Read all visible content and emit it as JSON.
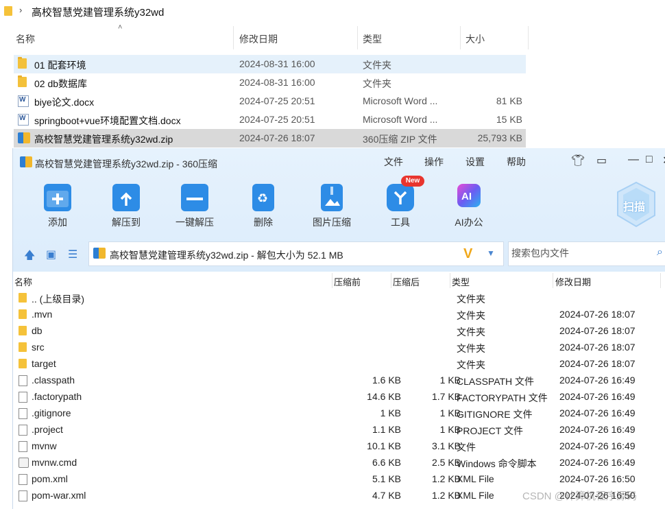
{
  "explorer": {
    "breadcrumb": "高校智慧党建管理系统y32wd",
    "columns": {
      "name": "名称",
      "modified": "修改日期",
      "type": "类型",
      "size": "大小"
    },
    "rows": [
      {
        "name": "01 配套环境",
        "date": "2024-08-31 16:00",
        "type": "文件夹",
        "size": ""
      },
      {
        "name": "02 db数据库",
        "date": "2024-08-31 16:00",
        "type": "文件夹",
        "size": ""
      },
      {
        "name": "biye论文.docx",
        "date": "2024-07-25 20:51",
        "type": "Microsoft Word ...",
        "size": "81 KB"
      },
      {
        "name": "springboot+vue环境配置文档.docx",
        "date": "2024-07-25 20:51",
        "type": "Microsoft Word ...",
        "size": "15 KB"
      },
      {
        "name": "高校智慧党建管理系统y32wd.zip",
        "date": "2024-07-26 18:07",
        "type": "360压缩 ZIP 文件",
        "size": "25,793 KB"
      }
    ]
  },
  "zip": {
    "title": "高校智慧党建管理系统y32wd.zip - 360压缩",
    "menu": [
      "文件",
      "操作",
      "设置",
      "帮助"
    ],
    "toolbar": [
      {
        "label": "添加",
        "icon": "add-icon",
        "color": "#2d8ce6"
      },
      {
        "label": "解压到",
        "icon": "extract-icon",
        "color": "#2d8ce6"
      },
      {
        "label": "一键解压",
        "icon": "one-click-extract-icon",
        "color": "#2d8ce6"
      },
      {
        "label": "删除",
        "icon": "recycle-icon",
        "color": "#2d8ce6"
      },
      {
        "label": "图片压缩",
        "icon": "image-compress-icon",
        "color": "#2d8ce6"
      },
      {
        "label": "工具",
        "icon": "tools-icon",
        "color": "#2d8ce6"
      },
      {
        "label": "AI办公",
        "icon": "ai-icon",
        "color": "#7b5cf0"
      }
    ],
    "new_badge": "New",
    "scan_label": "扫描",
    "address": "高校智慧党建管理系统y32wd.zip - 解包大小为 52.1 MB",
    "search_placeholder": "搜索包内文件",
    "columns": {
      "name": "名称",
      "compressed_before": "压缩前",
      "compressed_after": "压缩后",
      "type": "类型",
      "modified": "修改日期"
    },
    "rows": [
      {
        "name": ".. (上级目录)",
        "before": "",
        "after": "",
        "type": "文件夹",
        "date": "",
        "icon": "folder"
      },
      {
        "name": ".mvn",
        "before": "",
        "after": "",
        "type": "文件夹",
        "date": "2024-07-26 18:07",
        "icon": "folder"
      },
      {
        "name": "db",
        "before": "",
        "after": "",
        "type": "文件夹",
        "date": "2024-07-26 18:07",
        "icon": "folder"
      },
      {
        "name": "src",
        "before": "",
        "after": "",
        "type": "文件夹",
        "date": "2024-07-26 18:07",
        "icon": "folder"
      },
      {
        "name": "target",
        "before": "",
        "after": "",
        "type": "文件夹",
        "date": "2024-07-26 18:07",
        "icon": "folder"
      },
      {
        "name": ".classpath",
        "before": "1.6 KB",
        "after": "1 KB",
        "type": "CLASSPATH 文件",
        "date": "2024-07-26 16:49",
        "icon": "file"
      },
      {
        "name": ".factorypath",
        "before": "14.6 KB",
        "after": "1.7 KB",
        "type": "FACTORYPATH 文件",
        "date": "2024-07-26 16:49",
        "icon": "file"
      },
      {
        "name": ".gitignore",
        "before": "1 KB",
        "after": "1 KB",
        "type": "GITIGNORE 文件",
        "date": "2024-07-26 16:49",
        "icon": "file"
      },
      {
        "name": ".project",
        "before": "1.1 KB",
        "after": "1 KB",
        "type": "PROJECT 文件",
        "date": "2024-07-26 16:49",
        "icon": "file"
      },
      {
        "name": "mvnw",
        "before": "10.1 KB",
        "after": "3.1 KB",
        "type": "文件",
        "date": "2024-07-26 16:49",
        "icon": "file"
      },
      {
        "name": "mvnw.cmd",
        "before": "6.6 KB",
        "after": "2.5 KB",
        "type": "Windows 命令脚本",
        "date": "2024-07-26 16:49",
        "icon": "cmd"
      },
      {
        "name": "pom.xml",
        "before": "5.1 KB",
        "after": "1.2 KB",
        "type": "XML File",
        "date": "2024-07-26 16:50",
        "icon": "file"
      },
      {
        "name": "pom-war.xml",
        "before": "4.7 KB",
        "after": "1.2 KB",
        "type": "XML File",
        "date": "2024-07-26 16:50",
        "icon": "file"
      }
    ]
  },
  "watermark": "CSDN @计算机程序源码"
}
